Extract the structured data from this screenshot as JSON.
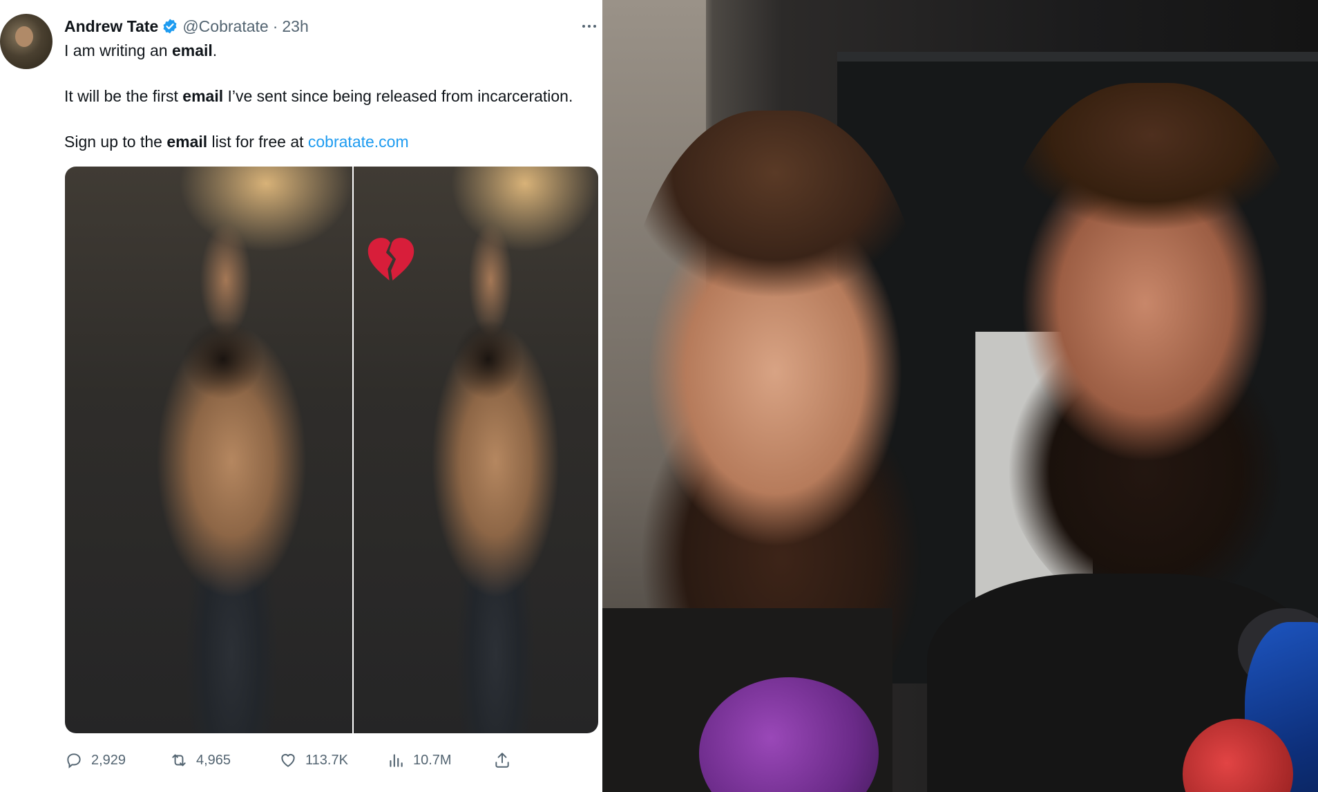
{
  "tweet": {
    "author": {
      "display_name": "Andrew Tate",
      "handle": "@Cobratate",
      "time": "23h",
      "verified": true
    },
    "lines": {
      "line1_pre": "I am writing an ",
      "line1_bold": "email",
      "line1_post": ".",
      "line2_pre": "It will be the first ",
      "line2_bold": "email",
      "line2_post": " I’ve sent since being released from incarceration.",
      "line3_pre": "Sign up to the ",
      "line3_bold": "email",
      "line3_mid": " list for free at ",
      "line3_link": "cobratate.com"
    },
    "media_emoji": "broken-heart",
    "stats": {
      "replies": "2,929",
      "retweets": "4,965",
      "likes": "113.7K",
      "views": "10.7M"
    }
  },
  "icons": {
    "verified": "verified-badge-icon",
    "more": "more-icon",
    "reply": "reply-icon",
    "retweet": "retweet-icon",
    "like": "like-icon",
    "views": "views-icon",
    "share": "share-icon",
    "broken_heart": "broken-heart-icon"
  },
  "colors": {
    "text": "#0f1419",
    "secondary": "#536471",
    "link": "#1d9bf0",
    "verified": "#1d9bf0"
  }
}
